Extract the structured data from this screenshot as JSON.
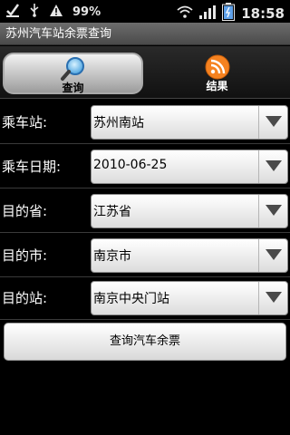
{
  "status_bar": {
    "battery_percent": "99%",
    "time": "18:58",
    "icons": [
      "check-icon",
      "usb-icon",
      "warning-icon",
      "wifi-icon",
      "signal-icon",
      "battery-icon"
    ]
  },
  "app": {
    "title": "苏州汽车站余票查询"
  },
  "tabs": [
    {
      "label": "查询",
      "icon": "magnifier-icon",
      "active": true
    },
    {
      "label": "结果",
      "icon": "rss-icon",
      "active": false
    }
  ],
  "form": {
    "fields": [
      {
        "label": "乘车站:",
        "value": "苏州南站"
      },
      {
        "label": "乘车日期:",
        "value": "2010-06-25"
      },
      {
        "label": "目的省:",
        "value": "江苏省"
      },
      {
        "label": "目的市:",
        "value": "南京市"
      },
      {
        "label": "目的站:",
        "value": "南京中央门站"
      }
    ],
    "submit_label": "查询汽车余票"
  },
  "colors": {
    "rss_orange": "#f58220",
    "tab_active_bg": "#d9d9d9"
  }
}
